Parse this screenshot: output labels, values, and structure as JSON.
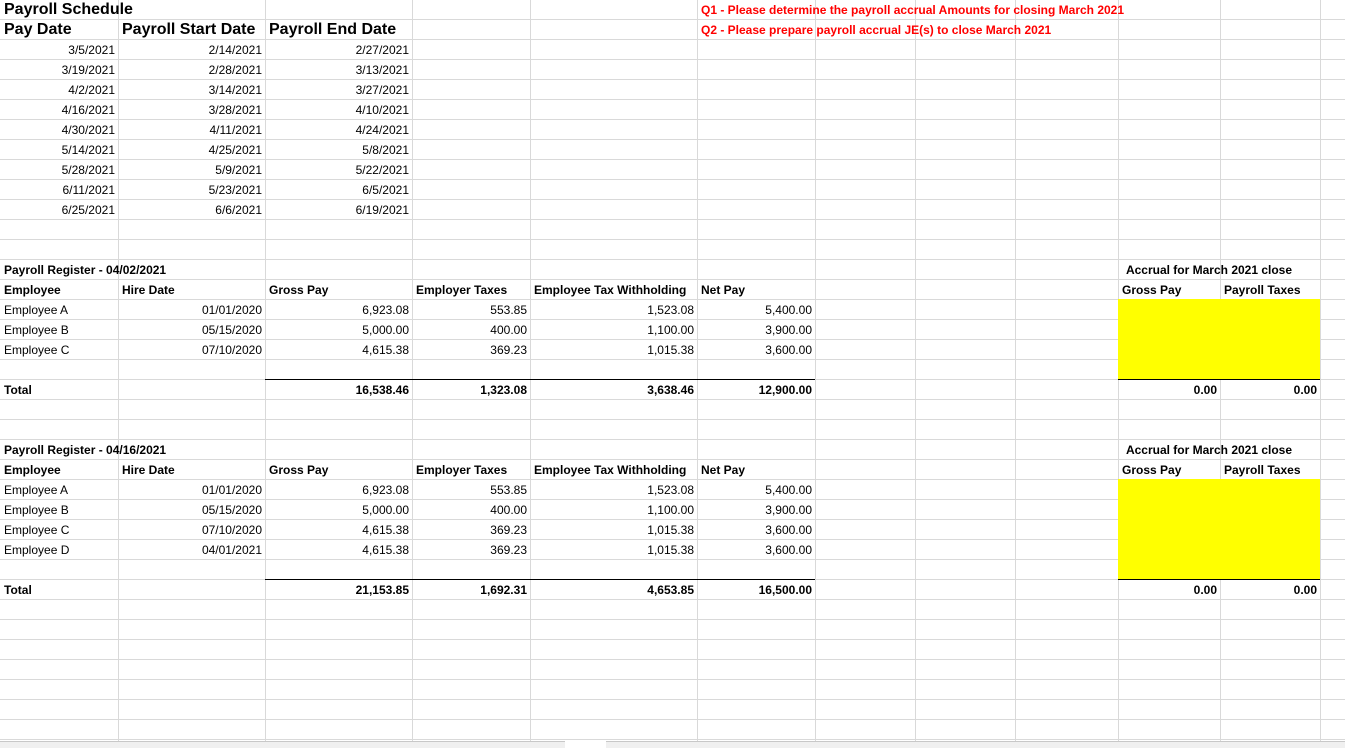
{
  "schedule": {
    "title": "Payroll Schedule",
    "headers": [
      "Pay Date",
      "Payroll Start Date",
      "Payroll End Date"
    ],
    "rows": [
      [
        "3/5/2021",
        "2/14/2021",
        "2/27/2021"
      ],
      [
        "3/19/2021",
        "2/28/2021",
        "3/13/2021"
      ],
      [
        "4/2/2021",
        "3/14/2021",
        "3/27/2021"
      ],
      [
        "4/16/2021",
        "3/28/2021",
        "4/10/2021"
      ],
      [
        "4/30/2021",
        "4/11/2021",
        "4/24/2021"
      ],
      [
        "5/14/2021",
        "4/25/2021",
        "5/8/2021"
      ],
      [
        "5/28/2021",
        "5/9/2021",
        "5/22/2021"
      ],
      [
        "6/11/2021",
        "5/23/2021",
        "6/5/2021"
      ],
      [
        "6/25/2021",
        "6/6/2021",
        "6/19/2021"
      ]
    ]
  },
  "questions": {
    "q1": "Q1 - Please determine the payroll accrual Amounts for closing March 2021",
    "q2": "Q2 - Please prepare payroll accrual JE(s) to close March 2021"
  },
  "register1": {
    "title": "Payroll Register - 04/02/2021",
    "headers": [
      "Employee",
      "Hire Date",
      "Gross Pay",
      "Employer Taxes",
      "Employee Tax Withholding",
      "Net Pay"
    ],
    "rows": [
      [
        "Employee A",
        "01/01/2020",
        "6,923.08",
        "553.85",
        "1,523.08",
        "5,400.00"
      ],
      [
        "Employee B",
        "05/15/2020",
        "5,000.00",
        "400.00",
        "1,100.00",
        "3,900.00"
      ],
      [
        "Employee C",
        "07/10/2020",
        "4,615.38",
        "369.23",
        "1,015.38",
        "3,600.00"
      ]
    ],
    "total_label": "Total",
    "totals": [
      "16,538.46",
      "1,323.08",
      "3,638.46",
      "12,900.00"
    ],
    "accrual": {
      "title": "Accrual for March 2021 close",
      "headers": [
        "Gross Pay",
        "Payroll Taxes"
      ],
      "totals": [
        "0.00",
        "0.00"
      ]
    }
  },
  "register2": {
    "title": "Payroll Register - 04/16/2021",
    "headers": [
      "Employee",
      "Hire Date",
      "Gross Pay",
      "Employer Taxes",
      "Employee Tax Withholding",
      "Net Pay"
    ],
    "rows": [
      [
        "Employee A",
        "01/01/2020",
        "6,923.08",
        "553.85",
        "1,523.08",
        "5,400.00"
      ],
      [
        "Employee B",
        "05/15/2020",
        "5,000.00",
        "400.00",
        "1,100.00",
        "3,900.00"
      ],
      [
        "Employee C",
        "07/10/2020",
        "4,615.38",
        "369.23",
        "1,015.38",
        "3,600.00"
      ],
      [
        "Employee D",
        "04/01/2021",
        "4,615.38",
        "369.23",
        "1,015.38",
        "3,600.00"
      ]
    ],
    "total_label": "Total",
    "totals": [
      "21,153.85",
      "1,692.31",
      "4,653.85",
      "16,500.00"
    ],
    "accrual": {
      "title": "Accrual for March 2021 close",
      "headers": [
        "Gross Pay",
        "Payroll Taxes"
      ],
      "totals": [
        "0.00",
        "0.00"
      ]
    }
  },
  "colors": {
    "question_text": "#ff0000",
    "accrual_fill": "#ffff00",
    "gridline": "#d9d9d9"
  }
}
